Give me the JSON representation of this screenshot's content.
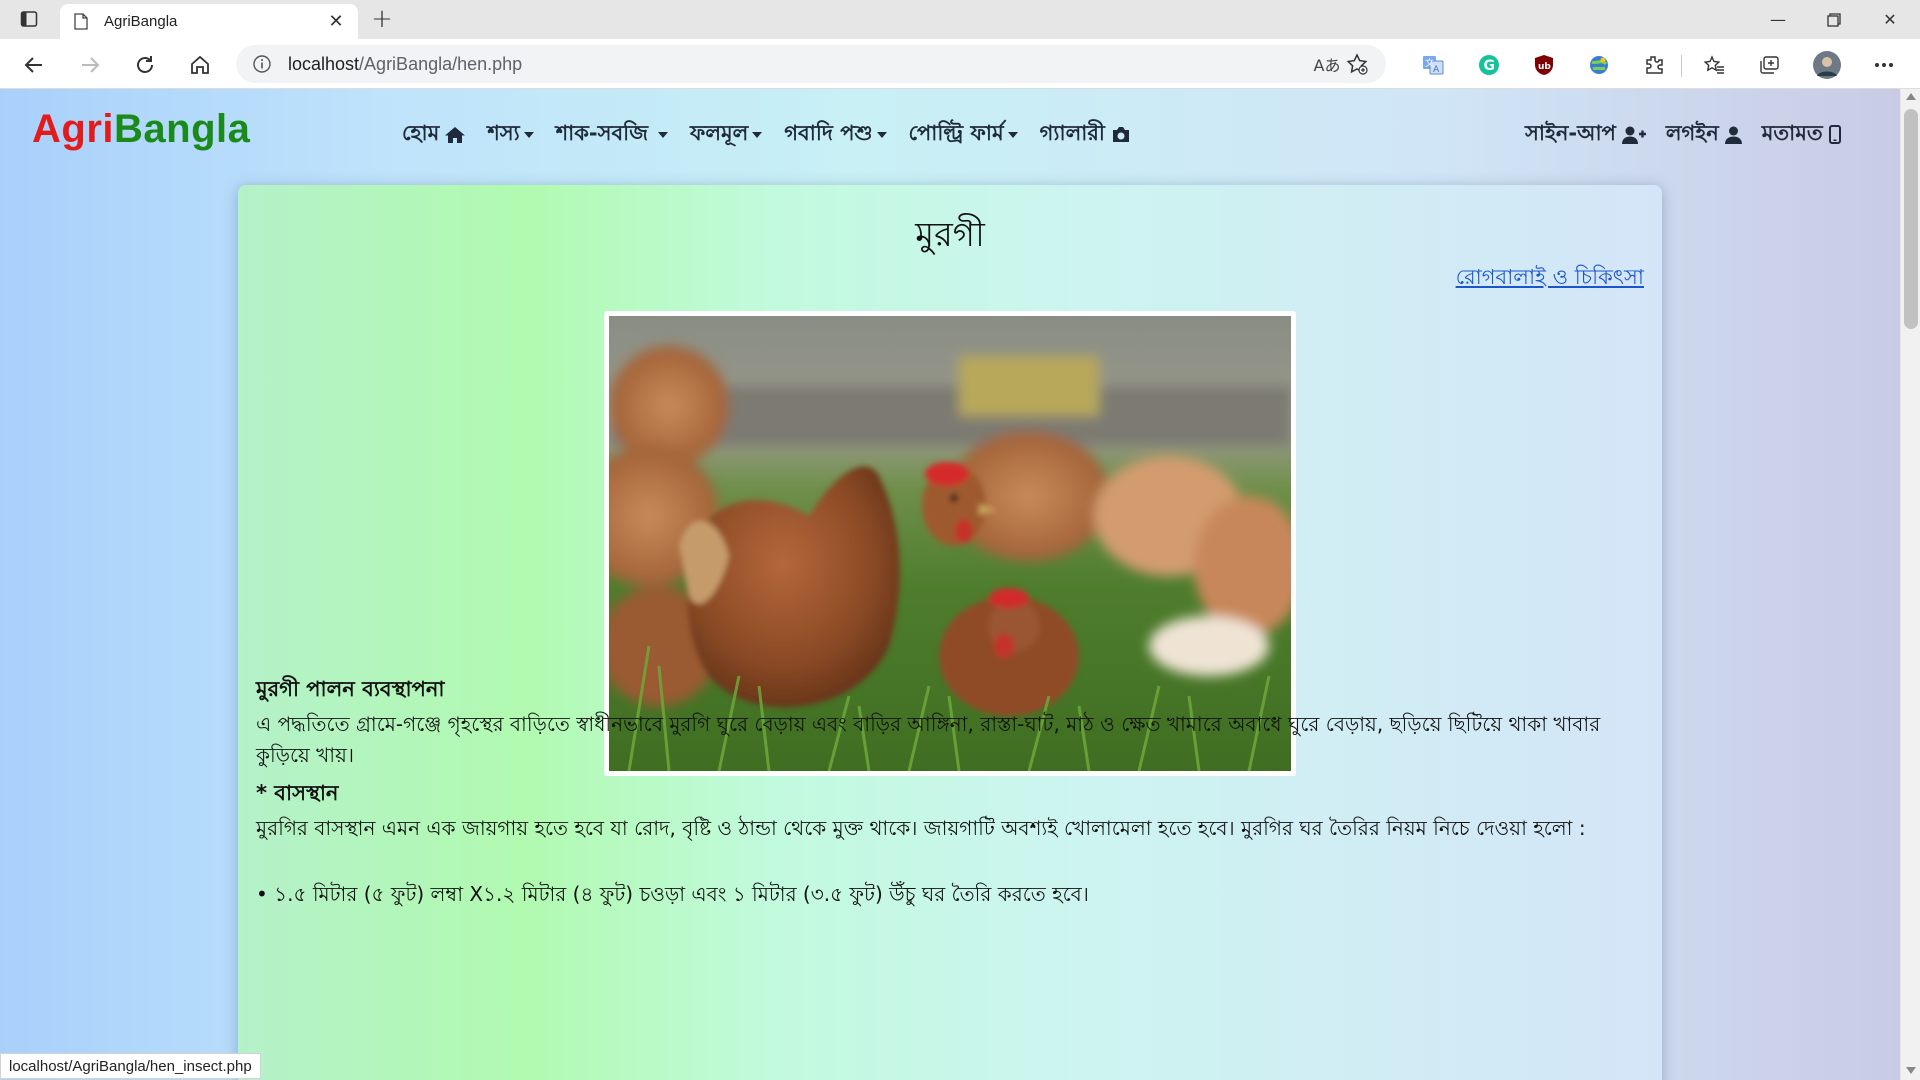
{
  "browser": {
    "tab_title": "AgriBangla",
    "url_host": "localhost",
    "url_path": "/AgriBangla/hen.php",
    "read_aloud_label": "Aあ",
    "status_url": "localhost/AgriBangla/hen_insect.php"
  },
  "site": {
    "brand_part1": "Agri",
    "brand_part2": "Bangla",
    "brand_colors": {
      "agri": "#e41b1b",
      "bangla": "#1a8a1a"
    },
    "nav": [
      {
        "label": "হোম",
        "icon": "home-icon"
      },
      {
        "label": "শস্য",
        "icon": "caret-down-icon"
      },
      {
        "label": "শাক-সবজি",
        "icon": "caret-down-icon"
      },
      {
        "label": "ফলমূল",
        "icon": "caret-down-icon"
      },
      {
        "label": "গবাদি পশু",
        "icon": "caret-down-icon"
      },
      {
        "label": "পোল্ট্রি ফার্ম",
        "icon": "caret-down-icon"
      },
      {
        "label": "গ্যালারী",
        "icon": "camera-icon"
      }
    ],
    "nav_right": [
      {
        "label": "সাইন-আপ",
        "icon": "user-plus-icon"
      },
      {
        "label": "লগইন",
        "icon": "user-icon"
      },
      {
        "label": "মতামত",
        "icon": "mobile-icon"
      }
    ]
  },
  "content": {
    "title": "মুরগী",
    "disease_link": "রোগবালাই ও চিকিৎসা",
    "image_subject": "hens-in-grass-photo",
    "section1_heading": "মুরগী পালন ব্যবস্থাপনা",
    "section1_text": "এ পদ্ধতিতে গ্রামে-গঞ্জে গৃহস্থের বাড়িতে স্বাধীনভাবে মুরগি ঘুরে বেড়ায় এবং বাড়ির আঙ্গিনা, রাস্তা-ঘাট, মাঠ ও ক্ষেত খামারে অবাধে ঘুরে বেড়ায়, ছড়িয়ে ছিটিয়ে থাকা খাবার কুড়িয়ে খায়।",
    "section2_heading": "* বাসস্থান",
    "section2_text": "মুরগির বাসস্থান এমন এক জায়গায় হতে হবে যা রোদ, বৃষ্টি ও ঠান্ডা থেকে মুক্ত থাকে। জায়গাটি অবশ্যই খোলামেলা হতে হবে। মুরগির ঘর তৈরির নিয়ম নিচে দেওয়া হলো :",
    "bullet1": "• ১.৫ মিটার (৫ ফুট) লম্বা X১.২ মিটার (৪ ফুট) চওড়া এবং ১ মিটার (৩.৫ ফুট) উঁচু ঘর তৈরি করতে হবে।"
  }
}
